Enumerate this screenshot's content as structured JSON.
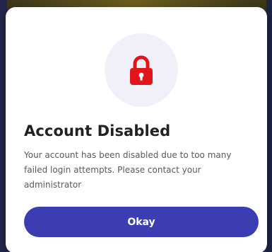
{
  "dialog": {
    "icon": "lock-icon",
    "title": "Account Disabled",
    "message": "Your account has been disabled due to too many failed login attempts. Please contact your administrator",
    "button_label": "Okay"
  },
  "colors": {
    "accent": "#3c3db3",
    "icon": "#e0161b",
    "icon_bg": "#f1f0f8"
  }
}
